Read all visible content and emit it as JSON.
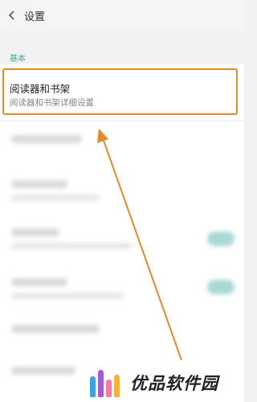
{
  "header": {
    "title": "设置",
    "back_icon": "chevron-left-icon"
  },
  "section": {
    "label": "基本"
  },
  "reader_item": {
    "title": "阅读器和书架",
    "subtitle": "阅读器和书架详细设置"
  },
  "colors": {
    "highlight": "#e38a2a",
    "accent": "#3aa6a0",
    "toggle": "#a8d9d3"
  },
  "watermark": {
    "text": "优品软件园"
  }
}
